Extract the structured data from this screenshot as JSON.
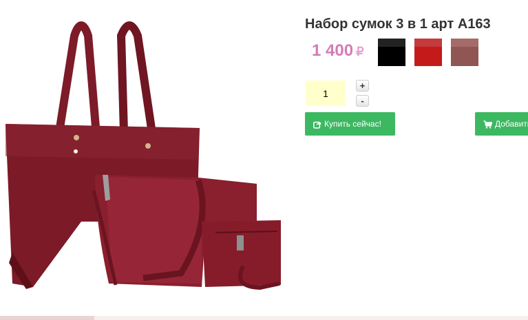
{
  "product": {
    "title": "Набор сумок 3 в 1 арт А163",
    "price": "1 400",
    "currency": "₽",
    "image_icon": "handbag-set-image"
  },
  "swatches": [
    {
      "name": "black",
      "color": "#000000"
    },
    {
      "name": "red",
      "color": "#c41a1a"
    },
    {
      "name": "brown",
      "color": "#8f5654"
    }
  ],
  "quantity": {
    "value": "1",
    "plus_label": "+",
    "minus_label": "-"
  },
  "actions": {
    "buy_now_label": "Купить сейчас!",
    "buy_now_icon": "share-icon",
    "add_to_cart_label": "Добавить",
    "add_to_cart_icon": "cart-icon",
    "accent_color": "#3cb861",
    "price_color": "#d47bb6"
  }
}
